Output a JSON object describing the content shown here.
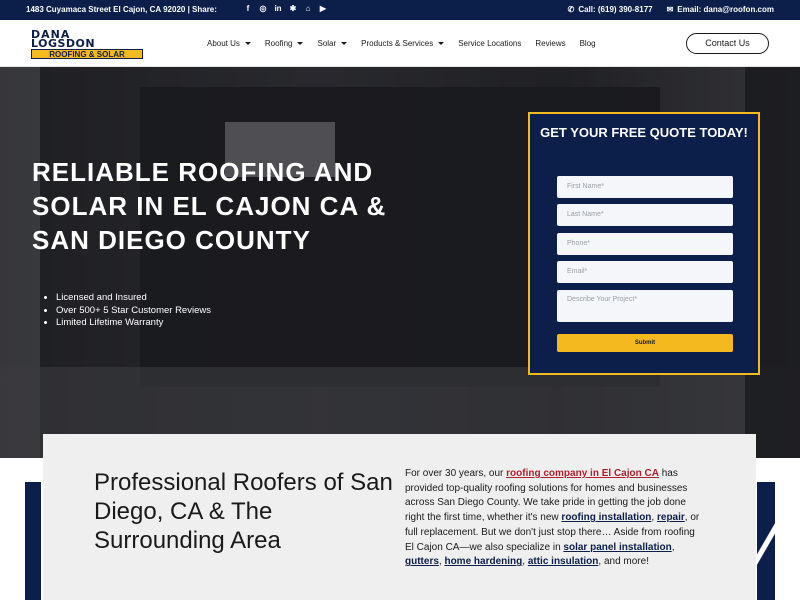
{
  "topbar": {
    "address": "1483 Cuyamaca Street El Cajon, CA 92020 | Share:",
    "socials": [
      {
        "icon": "facebook-icon",
        "glyph": "f"
      },
      {
        "icon": "instagram-icon",
        "glyph": "◎"
      },
      {
        "icon": "linkedin-icon",
        "glyph": "in"
      },
      {
        "icon": "yelp-icon",
        "glyph": "✱"
      },
      {
        "icon": "houzz-icon",
        "glyph": "⌂"
      },
      {
        "icon": "youtube-icon",
        "glyph": "▶"
      }
    ],
    "phone_label": "Call: (619) 390-8177",
    "email_label": "Email: dana@roofon.com"
  },
  "logo": {
    "line1": "DANA",
    "line2": "LOGSDON",
    "line3": "ROOFING & SOLAR"
  },
  "nav": {
    "items": [
      {
        "label": "About Us",
        "has_dropdown": true
      },
      {
        "label": "Roofing",
        "has_dropdown": true
      },
      {
        "label": "Solar",
        "has_dropdown": true
      },
      {
        "label": "Products & Services",
        "has_dropdown": true
      },
      {
        "label": "Service Locations",
        "has_dropdown": false
      },
      {
        "label": "Reviews",
        "has_dropdown": false
      },
      {
        "label": "Blog",
        "has_dropdown": false
      }
    ],
    "contact_button": "Contact Us"
  },
  "hero": {
    "title": "RELIABLE ROOFING AND SOLAR IN EL CAJON CA & SAN DIEGO COUNTY",
    "bullets": [
      "Licensed and Insured",
      "Over 500+ 5 Star Customer Reviews",
      "Limited Lifetime Warranty"
    ]
  },
  "quote_form": {
    "title": "GET YOUR FREE QUOTE TODAY!",
    "first_name_placeholder": "First Name*",
    "last_name_placeholder": "Last Name*",
    "phone_placeholder": "Phone*",
    "email_placeholder": "Email*",
    "project_placeholder": "Describe Your Project*",
    "submit_label": "Submit"
  },
  "about": {
    "heading": "Professional Roofers of San Diego, CA & The Surrounding Area",
    "p1": "For over 30 years, our ",
    "link_company": "roofing company in El Cajon CA",
    "p2": " has provided top-quality roofing solutions for homes and businesses across San Diego County. We take pride in getting the job done right the first time, whether it's new ",
    "link_install": "roofing installation",
    "p3": ", ",
    "link_repair": "repair",
    "p4": ", or full replacement. But we don't just stop there… Aside from roofing El Cajon CA—we also specialize in ",
    "link_solar": "solar panel installation",
    "p5": ", ",
    "link_gutters": "gutters",
    "p6": ", ",
    "link_hardening": "home hardening",
    "p7": ", ",
    "link_insulation": "attic insulation",
    "p8": ", and more!"
  },
  "colors": {
    "navy": "#0b1f4a",
    "gold": "#f5b920",
    "link_red": "#b01e2d"
  }
}
